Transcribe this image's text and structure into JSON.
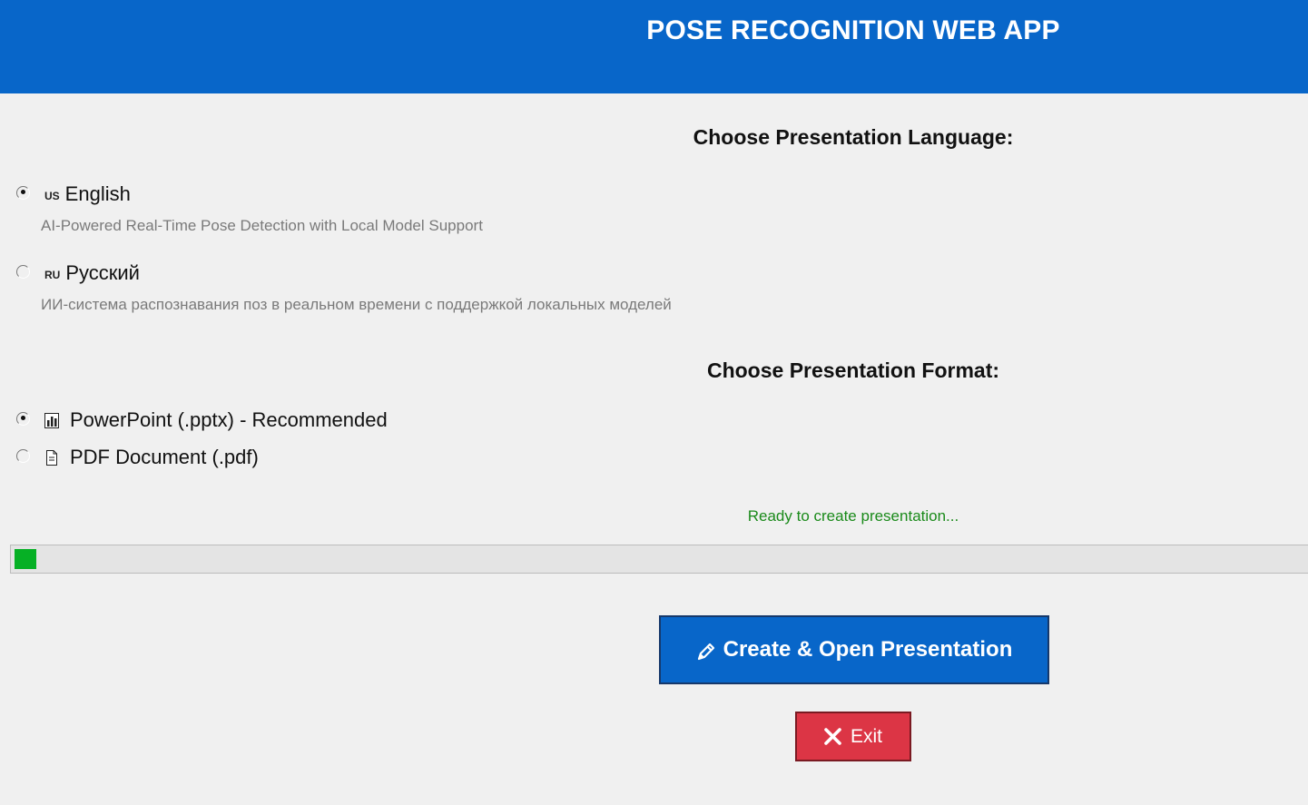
{
  "header": {
    "title": "POSE RECOGNITION WEB APP",
    "bg_color": "#0866c9"
  },
  "language_section": {
    "title": "Choose Presentation Language:",
    "options": [
      {
        "flag": "US",
        "label": "English",
        "description": "AI-Powered Real-Time Pose Detection with Local Model Support",
        "selected": true
      },
      {
        "flag": "RU",
        "label": "Русский",
        "description": "ИИ-система распознавания поз в реальном времени с поддержкой локальных моделей",
        "selected": false
      }
    ]
  },
  "format_section": {
    "title": "Choose Presentation Format:",
    "options": [
      {
        "icon": "bar-chart-icon",
        "label": "PowerPoint (.pptx) - Recommended",
        "selected": true
      },
      {
        "icon": "document-icon",
        "label": "PDF Document (.pdf)",
        "selected": false
      }
    ]
  },
  "status": {
    "text": "Ready to create presentation...",
    "color": "#1a8a1a"
  },
  "progress": {
    "value_fraction": 0.017,
    "fill_color": "#06b025"
  },
  "actions": {
    "create_label": "Create & Open Presentation",
    "create_icon": "pencil-icon",
    "exit_label": "Exit",
    "exit_icon": "close-icon",
    "exit_color": "#dc3545"
  }
}
